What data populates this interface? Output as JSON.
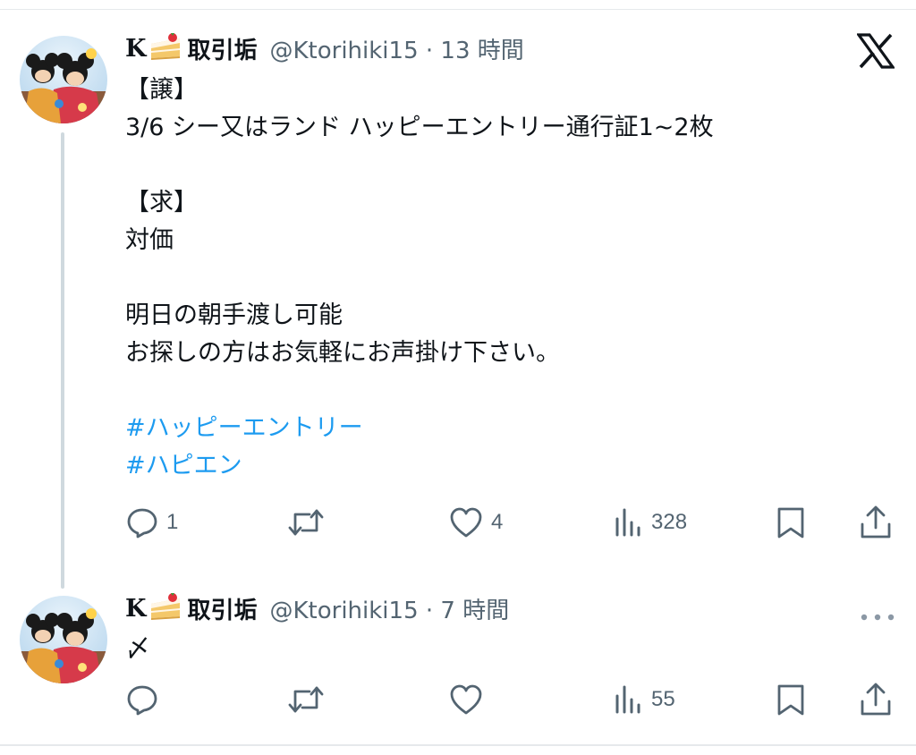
{
  "tweet1": {
    "name_prefix": "K",
    "name_suffix": "取引垢",
    "handle_time": "@Ktorihiki15 · 13 時間",
    "lines": [
      "【譲】",
      "3/6 シー又はランド ハッピーエントリー通行証1~2枚",
      "",
      "【求】",
      "対価",
      "",
      "明日の朝手渡し可能",
      "お探しの方はお気軽にお声掛け下さい。",
      ""
    ],
    "hashtags": [
      "#ハッピーエントリー",
      "#ハピエン"
    ],
    "actions": {
      "reply_count": "1",
      "retweet_count": "",
      "like_count": "4",
      "views_count": "328"
    }
  },
  "tweet2": {
    "name_prefix": "K",
    "name_suffix": "取引垢",
    "handle_time": "@Ktorihiki15 · 7 時間",
    "body": "〆",
    "actions": {
      "reply_count": "",
      "retweet_count": "",
      "like_count": "",
      "views_count": "55"
    }
  },
  "icons": {
    "x_logo": "x-logo-icon",
    "more": "more-dots-icon",
    "cake": "cake-icon"
  },
  "colors": {
    "text": "#0f1419",
    "secondary": "#536471",
    "hashtag": "#1d9bf0",
    "thread_line": "#cfd9de"
  }
}
